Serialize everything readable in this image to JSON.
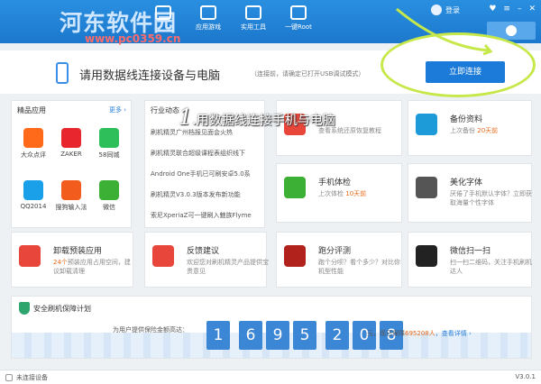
{
  "header": {
    "watermark": "河东软件园",
    "watermark_url": "www.pc0359.cn",
    "tabs": [
      {
        "label": "应用游戏"
      },
      {
        "label": "实用工具"
      },
      {
        "label": "一键Root"
      }
    ],
    "login": "登录"
  },
  "connect": {
    "title": "请用数据线连接设备与电脑",
    "hint": "（连接前，请确定已打开USB调试模式）",
    "button": "立即连接",
    "annotation_num": "1",
    "annotation": "用数据线连接手机与电脑"
  },
  "apps": {
    "title": "精品应用",
    "more": "更多 ›",
    "items": [
      {
        "label": "大众点评",
        "color": "#ff6a1a"
      },
      {
        "label": "ZAKER",
        "color": "#e8262e"
      },
      {
        "label": "58同城",
        "color": "#2fbf5a"
      },
      {
        "label": "QQ2014",
        "color": "#1aa0e8"
      },
      {
        "label": "搜狗输入法",
        "color": "#f25c1c"
      },
      {
        "label": "微信",
        "color": "#3cb034"
      }
    ]
  },
  "news": {
    "title": "行业动态",
    "items": [
      "刷机精灵广州档报见面会火热",
      "刷机精灵联合超级课程表组织线下",
      "Android One手机已可刷安卓5.0系",
      "刷机精灵V3.0.3版本发布新功能",
      "索尼XperiaZ可一键刷入魅族Flyme"
    ]
  },
  "tiles": [
    {
      "title": "",
      "desc": "查看系统还原恢复教程",
      "icon": "#e8463a"
    },
    {
      "title": "备份资料",
      "desc_a": "上次备份",
      "desc_b": "20天前",
      "icon": "#1c9bd8"
    },
    {
      "title": "手机体检",
      "desc_a": "上次体检",
      "desc_b": "10天前",
      "icon": "#3cb034"
    },
    {
      "title": "美化字体",
      "desc": "厌倦了手机默认字体？立即获取海量个性字体",
      "icon": "#555555"
    },
    {
      "title": "卸载预装应用",
      "desc_a": "24个",
      "desc_b": "预装应用",
      "desc_c": "占用",
      "desc_d": "空间，建议卸载清理",
      "icon": "#e8463a"
    },
    {
      "title": "反馈建议",
      "desc": "欢迎您对刷机精灵产品提供宝贵意见",
      "icon": "#e8463a"
    },
    {
      "title": "跑分评测",
      "desc": "跑个分呗？看个多少？对比你机型性能",
      "icon": "#b2221c"
    },
    {
      "title": "微信扫一扫",
      "desc": "扫一扫二维码，关注手机刷机达人",
      "icon": "#222222"
    }
  ],
  "safe": {
    "title": "安全刷机保障计划",
    "count_label": "为用户提供保险金额高达：",
    "digits": [
      "1",
      "6",
      "9",
      "5",
      "2",
      "0",
      "8"
    ],
    "tail_a": "元，现已保障",
    "tail_b": "695208人",
    "tail_c": "，查看详情 ›"
  },
  "status": {
    "text": "未连接设备",
    "version": "V3.0.1"
  }
}
